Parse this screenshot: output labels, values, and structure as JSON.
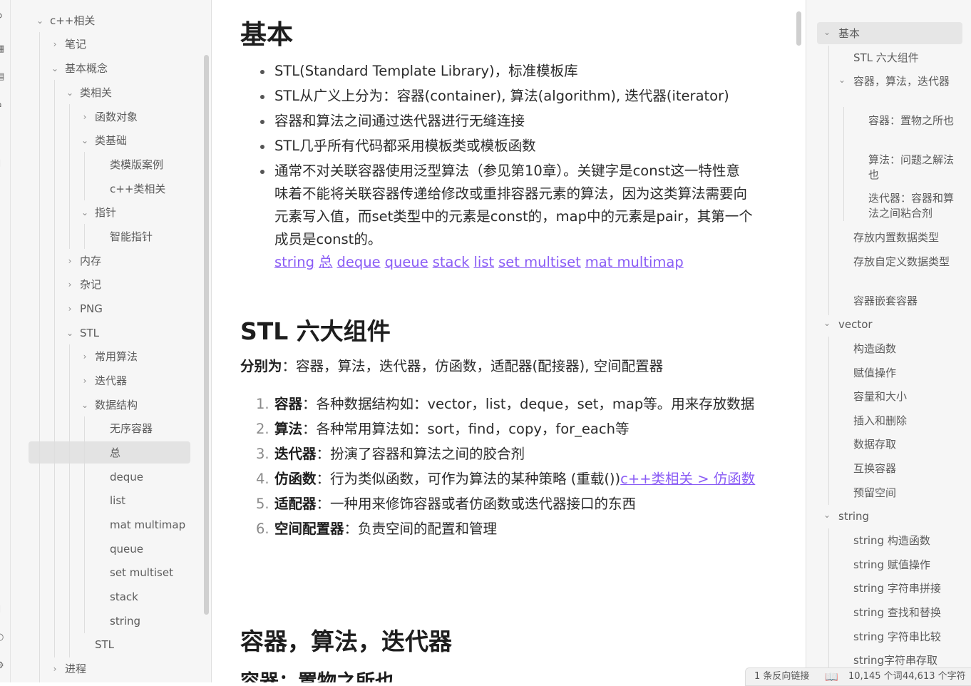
{
  "explorer": {
    "items": [
      {
        "label": "c++相关",
        "chevron": "down"
      },
      {
        "label": "笔记",
        "chevron": "right"
      },
      {
        "label": "基本概念",
        "chevron": "down"
      },
      {
        "label": "类相关",
        "chevron": "down"
      },
      {
        "label": "函数对象",
        "chevron": "right"
      },
      {
        "label": "类基础",
        "chevron": "down"
      },
      {
        "label": "类模版案例",
        "chevron": ""
      },
      {
        "label": "c++类相关",
        "chevron": ""
      },
      {
        "label": "指针",
        "chevron": "down"
      },
      {
        "label": "智能指针",
        "chevron": ""
      },
      {
        "label": "内存",
        "chevron": "right"
      },
      {
        "label": "杂记",
        "chevron": "right"
      },
      {
        "label": "PNG",
        "chevron": "right"
      },
      {
        "label": "STL",
        "chevron": "down"
      },
      {
        "label": "常用算法",
        "chevron": "right"
      },
      {
        "label": "迭代器",
        "chevron": "right"
      },
      {
        "label": "数据结构",
        "chevron": "down"
      },
      {
        "label": "无序容器",
        "chevron": ""
      },
      {
        "label": "总",
        "chevron": "",
        "active": true
      },
      {
        "label": "deque",
        "chevron": ""
      },
      {
        "label": "list",
        "chevron": ""
      },
      {
        "label": "mat multimap",
        "chevron": ""
      },
      {
        "label": "queue",
        "chevron": ""
      },
      {
        "label": "set multiset",
        "chevron": ""
      },
      {
        "label": "stack",
        "chevron": ""
      },
      {
        "label": "string",
        "chevron": ""
      },
      {
        "label": "STL",
        "chevron": ""
      },
      {
        "label": "进程",
        "chevron": "right"
      }
    ]
  },
  "editor": {
    "h1": "基本",
    "bullets": [
      "STL(Standard Template Library)，标准模板库",
      "STL从广义上分为：容器(container), 算法(algorithm), 迭代器(iterator)",
      "容器和算法之间通过迭代器进行无缝连接",
      "STL几乎所有代码都采用模板类或模板函数",
      "通常不对关联容器使用泛型算法（参见第10章）。关键字是const这一特性意味着不能将关联容器传递给修改或重排容器元素的算法，因为这类算法需要向元素写入值，而set类型中的元素是const的，map中的元素是pair，其第一个成员是const的。"
    ],
    "links": [
      "string",
      "总",
      "deque",
      "queue",
      "stack",
      "list",
      "set multiset",
      "mat multimap"
    ],
    "h2_components": "STL 六大组件",
    "components_intro_bold": "分别为",
    "components_intro_rest": "：容器，算法，迭代器，仿函数，适配器(配接器), 空间配置器",
    "numbered": [
      {
        "num": "1.",
        "bold": "容器",
        "text": "：各种数据结构如：vector，list，deque，set，map等。用来存放数据"
      },
      {
        "num": "2.",
        "bold": "算法",
        "text": "：各种常用算法如：sort，find，copy，for_each等"
      },
      {
        "num": "3.",
        "bold": "迭代器",
        "text": "：扮演了容器和算法之间的胶合剂"
      },
      {
        "num": "4.",
        "bold": "仿函数",
        "text": "：行为类似函数，可作为算法的某种策略 (重载())",
        "link": "c++类相关 > 仿函数"
      },
      {
        "num": "5.",
        "bold": "适配器",
        "text": "：一种用来修饰容器或者仿函数或迭代器接口的东西"
      },
      {
        "num": "6.",
        "bold": "空间配置器",
        "text": "：负责空间的配置和管理"
      }
    ],
    "h2_containers": "容器，算法，迭代器",
    "h3_partial": "容器：置物之所也"
  },
  "outline": {
    "items": [
      {
        "label": "基本",
        "chevron": "down",
        "active": true
      },
      {
        "label": "STL 六大组件"
      },
      {
        "label": "容器，算法，迭代器",
        "chevron": "down"
      },
      {
        "label": "容器：置物之所也"
      },
      {
        "label": "算法：问题之解法也"
      },
      {
        "label": "迭代器：容器和算法之间粘合剂"
      },
      {
        "label": "存放内置数据类型"
      },
      {
        "label": "存放自定义数据类型"
      },
      {
        "label": "容器嵌套容器"
      },
      {
        "label": "vector",
        "chevron": "down"
      },
      {
        "label": "构造函数"
      },
      {
        "label": "赋值操作"
      },
      {
        "label": "容量和大小"
      },
      {
        "label": "插入和删除"
      },
      {
        "label": "数据存取"
      },
      {
        "label": "互换容器"
      },
      {
        "label": "预留空间"
      },
      {
        "label": "string",
        "chevron": "down"
      },
      {
        "label": "string 构造函数"
      },
      {
        "label": "string 赋值操作"
      },
      {
        "label": "string 字符串拼接"
      },
      {
        "label": "string 查找和替换"
      },
      {
        "label": "string 字符串比较"
      },
      {
        "label": "string字符串存取"
      }
    ]
  },
  "status": {
    "backlinks": "1 条反向链接",
    "words": "10,145 个词",
    "chars": "44,613 个字符"
  }
}
